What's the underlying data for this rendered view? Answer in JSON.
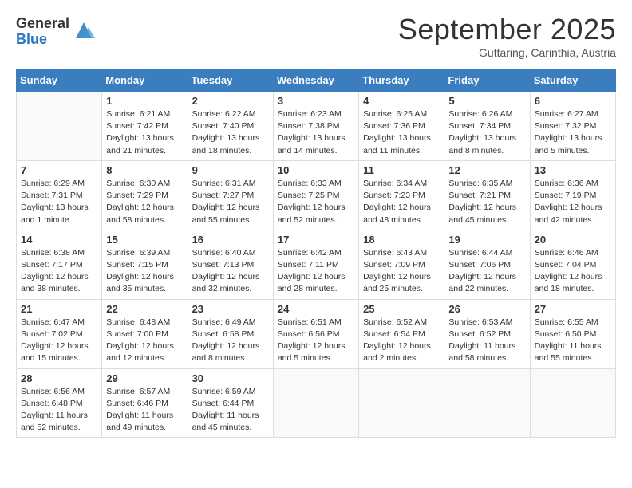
{
  "logo": {
    "general": "General",
    "blue": "Blue"
  },
  "header": {
    "month": "September 2025",
    "location": "Guttaring, Carinthia, Austria"
  },
  "weekdays": [
    "Sunday",
    "Monday",
    "Tuesday",
    "Wednesday",
    "Thursday",
    "Friday",
    "Saturday"
  ],
  "weeks": [
    [
      {
        "day": "",
        "info": ""
      },
      {
        "day": "1",
        "info": "Sunrise: 6:21 AM\nSunset: 7:42 PM\nDaylight: 13 hours\nand 21 minutes."
      },
      {
        "day": "2",
        "info": "Sunrise: 6:22 AM\nSunset: 7:40 PM\nDaylight: 13 hours\nand 18 minutes."
      },
      {
        "day": "3",
        "info": "Sunrise: 6:23 AM\nSunset: 7:38 PM\nDaylight: 13 hours\nand 14 minutes."
      },
      {
        "day": "4",
        "info": "Sunrise: 6:25 AM\nSunset: 7:36 PM\nDaylight: 13 hours\nand 11 minutes."
      },
      {
        "day": "5",
        "info": "Sunrise: 6:26 AM\nSunset: 7:34 PM\nDaylight: 13 hours\nand 8 minutes."
      },
      {
        "day": "6",
        "info": "Sunrise: 6:27 AM\nSunset: 7:32 PM\nDaylight: 13 hours\nand 5 minutes."
      }
    ],
    [
      {
        "day": "7",
        "info": "Sunrise: 6:29 AM\nSunset: 7:31 PM\nDaylight: 13 hours\nand 1 minute."
      },
      {
        "day": "8",
        "info": "Sunrise: 6:30 AM\nSunset: 7:29 PM\nDaylight: 12 hours\nand 58 minutes."
      },
      {
        "day": "9",
        "info": "Sunrise: 6:31 AM\nSunset: 7:27 PM\nDaylight: 12 hours\nand 55 minutes."
      },
      {
        "day": "10",
        "info": "Sunrise: 6:33 AM\nSunset: 7:25 PM\nDaylight: 12 hours\nand 52 minutes."
      },
      {
        "day": "11",
        "info": "Sunrise: 6:34 AM\nSunset: 7:23 PM\nDaylight: 12 hours\nand 48 minutes."
      },
      {
        "day": "12",
        "info": "Sunrise: 6:35 AM\nSunset: 7:21 PM\nDaylight: 12 hours\nand 45 minutes."
      },
      {
        "day": "13",
        "info": "Sunrise: 6:36 AM\nSunset: 7:19 PM\nDaylight: 12 hours\nand 42 minutes."
      }
    ],
    [
      {
        "day": "14",
        "info": "Sunrise: 6:38 AM\nSunset: 7:17 PM\nDaylight: 12 hours\nand 38 minutes."
      },
      {
        "day": "15",
        "info": "Sunrise: 6:39 AM\nSunset: 7:15 PM\nDaylight: 12 hours\nand 35 minutes."
      },
      {
        "day": "16",
        "info": "Sunrise: 6:40 AM\nSunset: 7:13 PM\nDaylight: 12 hours\nand 32 minutes."
      },
      {
        "day": "17",
        "info": "Sunrise: 6:42 AM\nSunset: 7:11 PM\nDaylight: 12 hours\nand 28 minutes."
      },
      {
        "day": "18",
        "info": "Sunrise: 6:43 AM\nSunset: 7:09 PM\nDaylight: 12 hours\nand 25 minutes."
      },
      {
        "day": "19",
        "info": "Sunrise: 6:44 AM\nSunset: 7:06 PM\nDaylight: 12 hours\nand 22 minutes."
      },
      {
        "day": "20",
        "info": "Sunrise: 6:46 AM\nSunset: 7:04 PM\nDaylight: 12 hours\nand 18 minutes."
      }
    ],
    [
      {
        "day": "21",
        "info": "Sunrise: 6:47 AM\nSunset: 7:02 PM\nDaylight: 12 hours\nand 15 minutes."
      },
      {
        "day": "22",
        "info": "Sunrise: 6:48 AM\nSunset: 7:00 PM\nDaylight: 12 hours\nand 12 minutes."
      },
      {
        "day": "23",
        "info": "Sunrise: 6:49 AM\nSunset: 6:58 PM\nDaylight: 12 hours\nand 8 minutes."
      },
      {
        "day": "24",
        "info": "Sunrise: 6:51 AM\nSunset: 6:56 PM\nDaylight: 12 hours\nand 5 minutes."
      },
      {
        "day": "25",
        "info": "Sunrise: 6:52 AM\nSunset: 6:54 PM\nDaylight: 12 hours\nand 2 minutes."
      },
      {
        "day": "26",
        "info": "Sunrise: 6:53 AM\nSunset: 6:52 PM\nDaylight: 11 hours\nand 58 minutes."
      },
      {
        "day": "27",
        "info": "Sunrise: 6:55 AM\nSunset: 6:50 PM\nDaylight: 11 hours\nand 55 minutes."
      }
    ],
    [
      {
        "day": "28",
        "info": "Sunrise: 6:56 AM\nSunset: 6:48 PM\nDaylight: 11 hours\nand 52 minutes."
      },
      {
        "day": "29",
        "info": "Sunrise: 6:57 AM\nSunset: 6:46 PM\nDaylight: 11 hours\nand 49 minutes."
      },
      {
        "day": "30",
        "info": "Sunrise: 6:59 AM\nSunset: 6:44 PM\nDaylight: 11 hours\nand 45 minutes."
      },
      {
        "day": "",
        "info": ""
      },
      {
        "day": "",
        "info": ""
      },
      {
        "day": "",
        "info": ""
      },
      {
        "day": "",
        "info": ""
      }
    ]
  ]
}
